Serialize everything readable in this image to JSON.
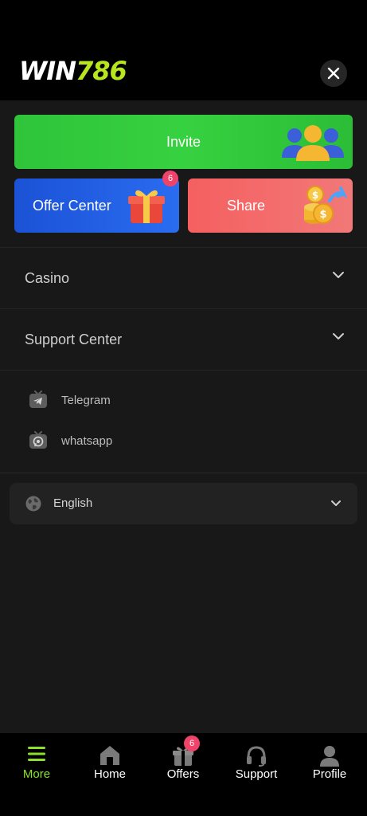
{
  "header": {
    "logo_win": "WIN",
    "logo_num": "786",
    "close_icon": "close-icon"
  },
  "actions": {
    "invite_label": "Invite",
    "offer_label": "Offer Center",
    "offer_badge": "6",
    "share_label": "Share"
  },
  "menu": {
    "casino_label": "Casino",
    "support_label": "Support Center",
    "support_items": [
      {
        "label": "Telegram",
        "icon": "telegram-icon"
      },
      {
        "label": "whatsapp",
        "icon": "whatsapp-icon"
      }
    ]
  },
  "language": {
    "selected": "English",
    "icon": "globe-icon"
  },
  "bottom_nav": {
    "items": [
      {
        "label": "More",
        "icon": "menu-icon",
        "active": true
      },
      {
        "label": "Home",
        "icon": "home-icon"
      },
      {
        "label": "Offers",
        "icon": "gift-icon",
        "badge": "6"
      },
      {
        "label": "Support",
        "icon": "headset-icon"
      },
      {
        "label": "Profile",
        "icon": "user-icon"
      }
    ]
  },
  "colors": {
    "accent_green": "#8be02b",
    "invite_green": "#36d140",
    "offer_blue": "#2a6cf0",
    "share_red": "#f56060",
    "badge_pink": "#f0436a"
  }
}
